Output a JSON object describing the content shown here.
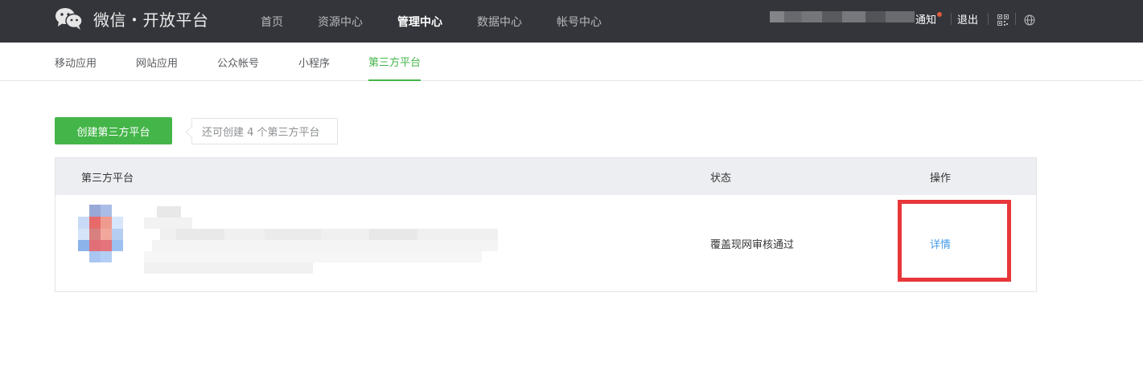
{
  "header": {
    "brand": "微信・开放平台",
    "nav": [
      {
        "label": "首页",
        "active": false
      },
      {
        "label": "资源中心",
        "active": false
      },
      {
        "label": "管理中心",
        "active": true
      },
      {
        "label": "数据中心",
        "active": false
      },
      {
        "label": "帐号中心",
        "active": false
      }
    ],
    "notify_label": "通知",
    "logout_label": "退出",
    "icons": {
      "logo": "wechat-logo-icon",
      "qr": "qr-code-icon",
      "lang": "globe-icon"
    }
  },
  "subnav": {
    "items": [
      {
        "label": "移动应用",
        "active": false
      },
      {
        "label": "网站应用",
        "active": false
      },
      {
        "label": "公众帐号",
        "active": false
      },
      {
        "label": "小程序",
        "active": false
      },
      {
        "label": "第三方平台",
        "active": true
      }
    ]
  },
  "actions": {
    "create_label": "创建第三方平台",
    "quota_tip": "还可创建 4 个第三方平台"
  },
  "table": {
    "headers": {
      "platform": "第三方平台",
      "status": "状态",
      "operation": "操作"
    },
    "rows": [
      {
        "status": "覆盖现网审核通过",
        "action_label": "详情"
      }
    ]
  },
  "colors": {
    "topbar": "#33353a",
    "accent_green": "#44b549",
    "link_blue": "#459ae9",
    "highlight_red": "#e8373a"
  }
}
